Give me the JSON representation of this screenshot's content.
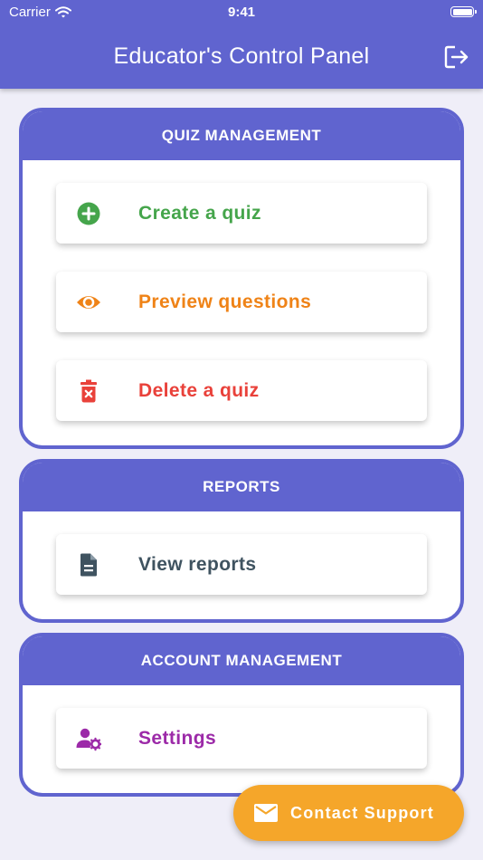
{
  "status_bar": {
    "carrier": "Carrier",
    "time": "9:41",
    "icons": [
      "wifi-icon",
      "battery-icon"
    ]
  },
  "header": {
    "title": "Educator's Control Panel",
    "logout_icon": "logout-icon",
    "background": "#6064cf"
  },
  "sections": [
    {
      "title": "QUIZ MANAGEMENT",
      "items": [
        {
          "label": "Create a quiz",
          "icon": "add-circle-icon",
          "color": "#45a54b"
        },
        {
          "label": "Preview questions",
          "icon": "eye-icon",
          "color": "#ef8317"
        },
        {
          "label": "Delete a quiz",
          "icon": "trash-icon",
          "color": "#e9413a"
        }
      ]
    },
    {
      "title": "REPORTS",
      "items": [
        {
          "label": "View reports",
          "icon": "document-icon",
          "color": "#3f5360"
        }
      ]
    },
    {
      "title": "ACCOUNT MANAGEMENT",
      "items": [
        {
          "label": "Settings",
          "icon": "user-settings-icon",
          "color": "#9c2aa8"
        }
      ]
    }
  ],
  "contact_button": {
    "label": "Contact Support",
    "icon": "mail-icon",
    "color": "#f5a62a"
  }
}
